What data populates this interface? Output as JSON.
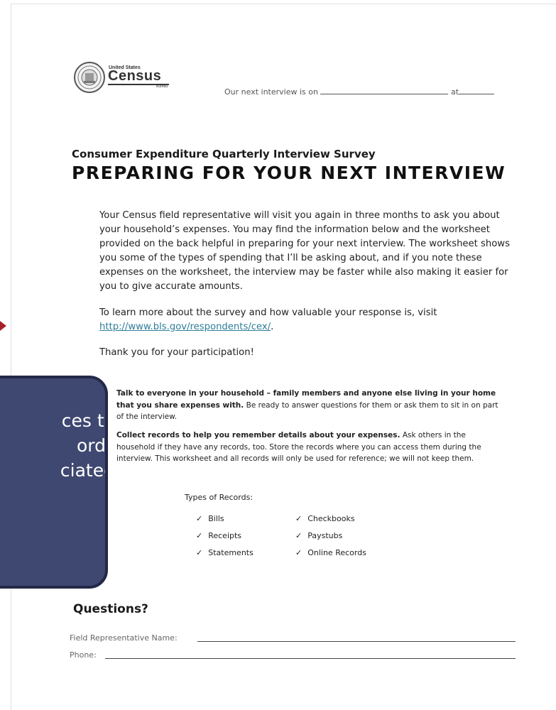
{
  "header": {
    "logo": {
      "small_text": "United States",
      "word": "Census",
      "sub_text": "Bureau"
    },
    "interview_prefix": "Our next interview is on",
    "interview_at": "at"
  },
  "document": {
    "subtitle": "Consumer Expenditure Quarterly Interview Survey",
    "title": "PREPARING FOR YOUR NEXT INTERVIEW",
    "paragraph_1": "Your Census field representative will visit you again in three months to ask you about your household’s expenses.  You may find the information below and the worksheet provided on the back helpful in preparing for your next interview.  The worksheet shows you some of the types of spending that I’ll be asking about, and if you note these expenses on the worksheet, the interview may be faster while also making it easier for you to give accurate amounts.",
    "paragraph_2_prefix": "To learn more about the survey and how valuable your response is, visit",
    "paragraph_2_link": "http://www.bls.gov/respondents/cex/",
    "paragraph_2_suffix": ".",
    "paragraph_3": "Thank you for your participation!",
    "bullet_1_bold": "Talk to everyone in your household – family members and anyone else living in your home that you share expenses with.",
    "bullet_1_rest": " Be ready to answer questions for them or ask them to sit in on part of the interview.",
    "bullet_2_bold": "Collect records to help you remember details about your expenses.",
    "bullet_2_rest": " Ask others in the household if they have any records, too.  Store the records where you can access them during the interview.  This worksheet and all records will only be used for reference; we will not keep them.",
    "types_title": "Types of Records:",
    "check_mark": "✓",
    "records": {
      "col1": [
        "Bills",
        "Receipts",
        "Statements"
      ],
      "col2": [
        "Checkbooks",
        "Paystubs",
        "Online Records"
      ]
    },
    "questions_title": "Questions?",
    "field_rep_label": "Field Representative Name:",
    "phone_label": "Phone:"
  },
  "callout": {
    "text_lines": [
      "ces to",
      "ords",
      "ciated"
    ],
    "fill_color": "#3e4870",
    "border_color": "#232947"
  },
  "arrow": {
    "color": "#a8202a"
  }
}
